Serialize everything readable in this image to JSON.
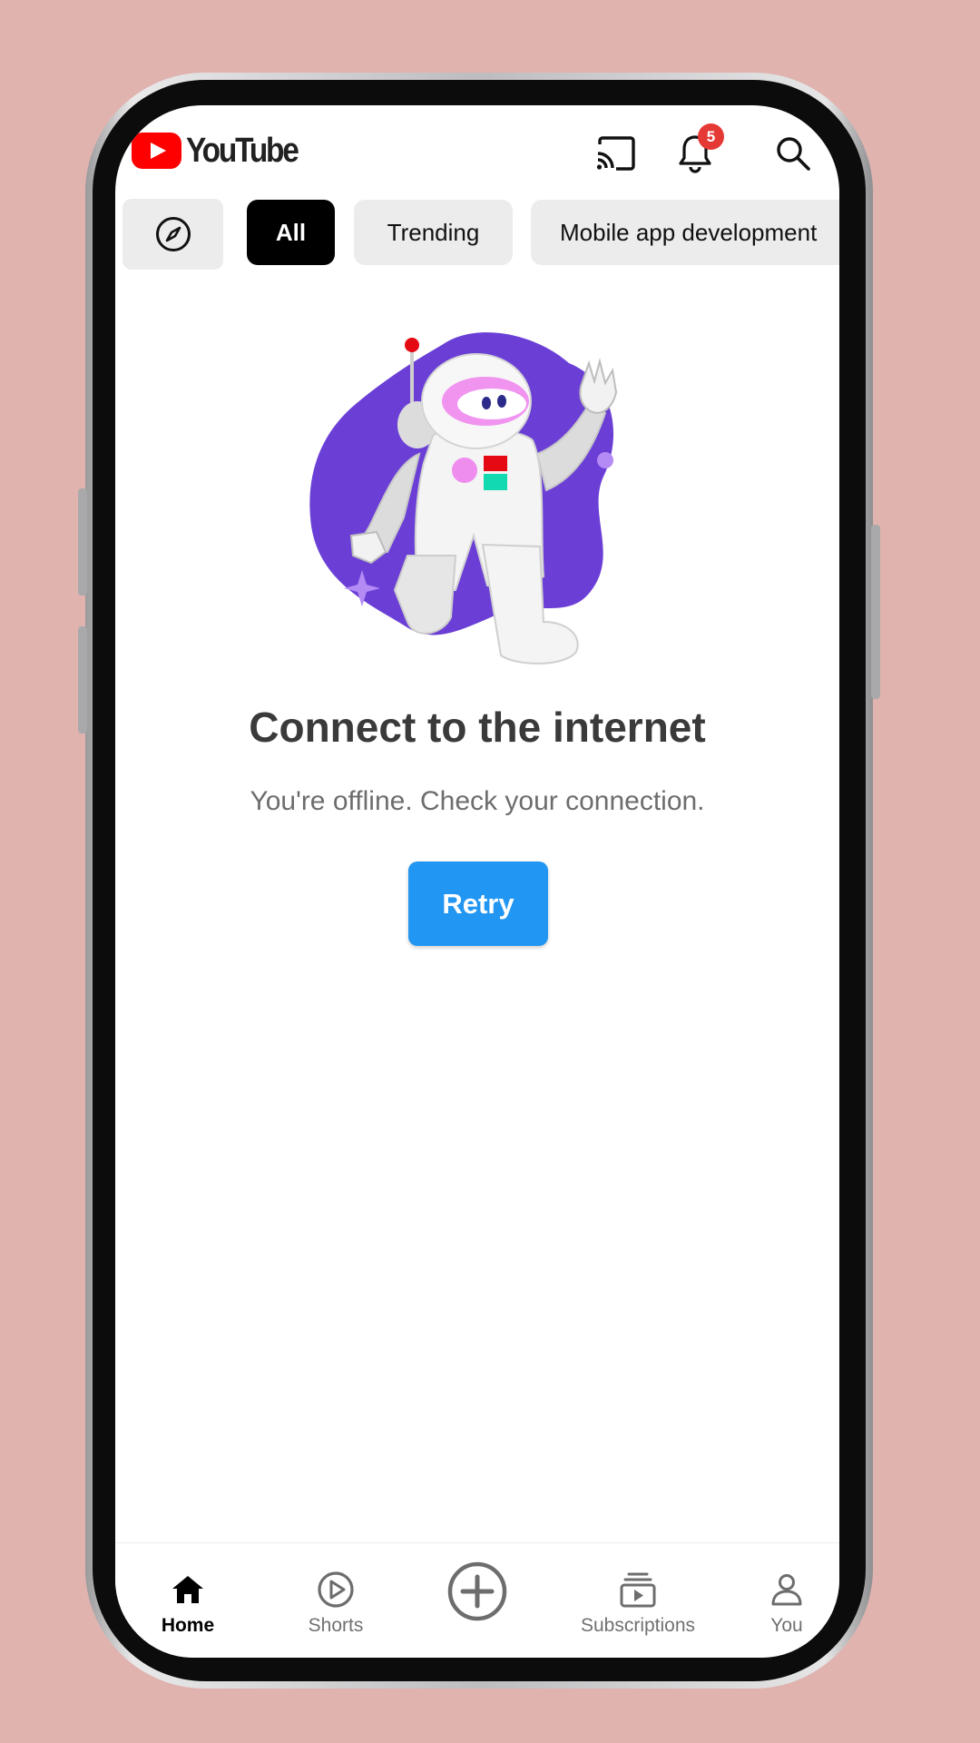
{
  "app": {
    "logo_text": "YouTube",
    "notification_count": "5"
  },
  "chips": [
    {
      "icon": "compass-icon",
      "label": ""
    },
    {
      "label": "All",
      "active": true
    },
    {
      "label": "Trending",
      "active": false
    },
    {
      "label": "Mobile app development",
      "active": false
    }
  ],
  "offline": {
    "title": "Connect to the internet",
    "message": "You're offline. Check your connection.",
    "retry_label": "Retry"
  },
  "nav": {
    "home": "Home",
    "shorts": "Shorts",
    "create_icon": "add-circle-icon",
    "subscriptions": "Subscriptions",
    "you": "You",
    "active": "home"
  },
  "colors": {
    "background": "#e0b3af",
    "brand_red": "#ff0000",
    "accent_blue": "#2196f3",
    "illustration_purple": "#6b3fd6",
    "badge_red": "#e53935"
  }
}
